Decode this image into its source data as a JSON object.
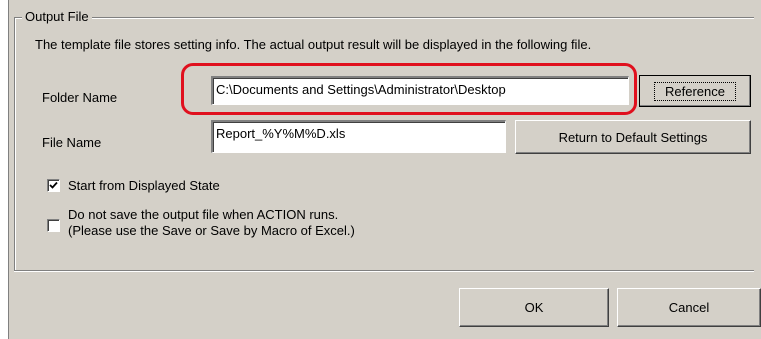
{
  "output_file": {
    "group_title": "Output File",
    "info_text": "The template file stores setting info. The actual output result will be displayed in the following file.",
    "folder_name_label": "Folder Name",
    "folder_name_value": "C:\\Documents and Settings\\Administrator\\Desktop",
    "reference_button": "Reference",
    "file_name_label": "File Name",
    "file_name_value": "Report_%Y%M%D.xls",
    "return_default_button": "Return to Default Settings",
    "start_displayed_label": "Start from Displayed State",
    "start_displayed_checked": true,
    "no_save_line1": "Do not save the output file when ACTION runs.",
    "no_save_line2": "(Please use the Save or Save by Macro of Excel.)",
    "no_save_checked": false
  },
  "footer": {
    "ok_button": "OK",
    "cancel_button": "Cancel"
  },
  "colors": {
    "dialog_bg": "#d4d0c8",
    "highlight": "#e0101e"
  }
}
